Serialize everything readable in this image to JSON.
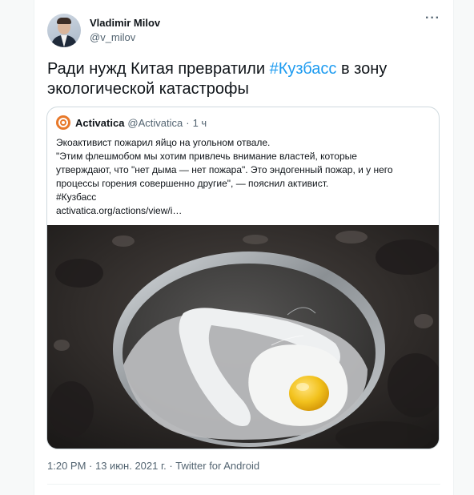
{
  "tweet": {
    "author_name": "Vladimir Milov",
    "author_handle": "@v_milov",
    "text_before": "Ради нужд Китая превратили ",
    "hashtag": "#Кузбасс",
    "text_after": " в зону экологической катастрофы",
    "more_icon": "more-horizontal-icon",
    "timestamp": "1:20 PM · 13 июн. 2021 г. · Twitter for Android"
  },
  "quote": {
    "author_name": "Activatica",
    "author_handle": "@Activatica",
    "separator": "·",
    "time": "1 ч",
    "lines": [
      "Экоактивист пожарил яйцо на угольном отвале.",
      "\"Этим флешмобом мы хотим привлечь внимание властей, которые",
      "утверждают, что \"нет дыма — нет пожара\". Это эндогенный пожар, и у него",
      "процессы горения совершенно другие\", — пояснил активист.",
      "#Кузбасс",
      "activatica.org/actions/view/i…"
    ]
  },
  "colors": {
    "accent": "#1d9bf0",
    "text": "#0f1419",
    "muted": "#536471",
    "border": "#cfd9de"
  }
}
